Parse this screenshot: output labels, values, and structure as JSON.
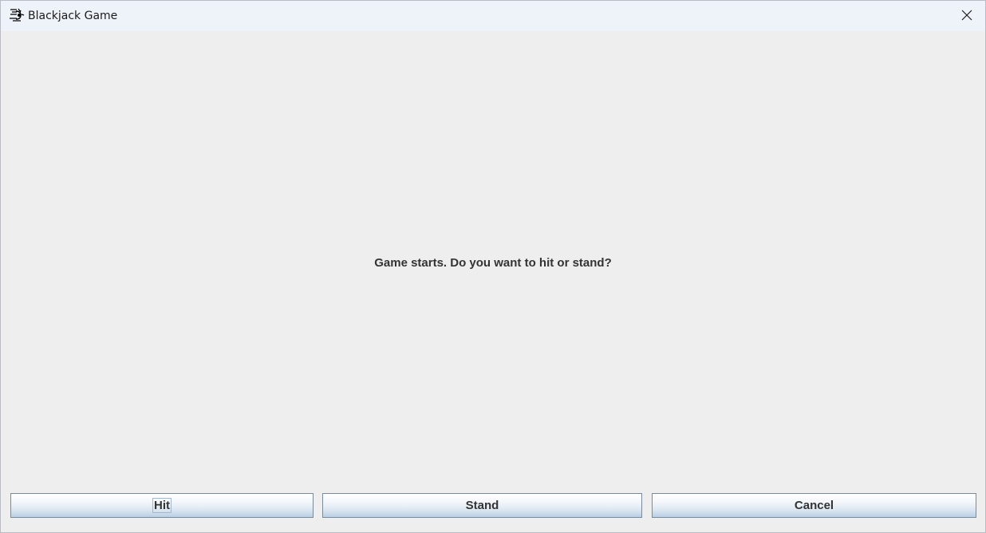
{
  "window": {
    "title": "Blackjack Game",
    "app_icon": "java-cup-icon",
    "close_icon": "close-icon"
  },
  "content": {
    "message": "Game starts. Do you want to hit or stand?"
  },
  "buttons": {
    "hit": "Hit",
    "stand": "Stand",
    "cancel": "Cancel"
  }
}
